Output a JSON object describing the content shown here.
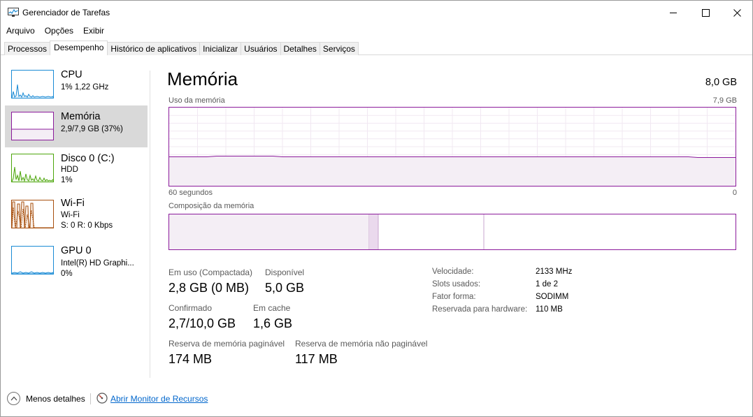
{
  "window": {
    "title": "Gerenciador de Tarefas"
  },
  "menu": [
    "Arquivo",
    "Opções",
    "Exibir"
  ],
  "tabs": [
    "Processos",
    "Desempenho",
    "Histórico de aplicativos",
    "Inicializar",
    "Usuários",
    "Detalhes",
    "Serviços"
  ],
  "active_tab": "Desempenho",
  "sidebar": {
    "items": [
      {
        "name": "CPU",
        "line1": "1%  1,22 GHz",
        "line2": "",
        "color": "#1a8bd5"
      },
      {
        "name": "Memória",
        "line1": "2,9/7,9 GB (37%)",
        "line2": "",
        "color": "#8b1a9b"
      },
      {
        "name": "Disco 0 (C:)",
        "line1": "HDD",
        "line2": "1%",
        "color": "#4da60c"
      },
      {
        "name": "Wi-Fi",
        "line1": "Wi-Fi",
        "line2": "S: 0  R: 0 Kbps",
        "color": "#a7500f"
      },
      {
        "name": "GPU 0",
        "line1": "Intel(R) HD Graphi...",
        "line2": "0%",
        "color": "#1a8bd5"
      }
    ]
  },
  "main": {
    "title": "Memória",
    "total": "8,0 GB",
    "usage_label": "Uso da memória",
    "usage_max": "7,9 GB",
    "time_left": "60 segundos",
    "time_right": "0",
    "composition_label": "Composição da memória",
    "usage_fraction": 0.37,
    "stats": {
      "in_use_label": "Em uso (Compactada)",
      "in_use_value": "2,8 GB (0 MB)",
      "available_label": "Disponível",
      "available_value": "5,0 GB",
      "committed_label": "Confirmado",
      "committed_value": "2,7/10,0 GB",
      "cached_label": "Em cache",
      "cached_value": "1,6 GB",
      "paged_label": "Reserva de memória paginável",
      "paged_value": "174 MB",
      "nonpaged_label": "Reserva de memória não paginável",
      "nonpaged_value": "117 MB"
    },
    "specs": [
      {
        "key": "Velocidade:",
        "value": "2133 MHz"
      },
      {
        "key": "Slots usados:",
        "value": "1 de 2"
      },
      {
        "key": "Fator forma:",
        "value": "SODIMM"
      },
      {
        "key": "Reservada para hardware:",
        "value": "110 MB"
      }
    ]
  },
  "footer": {
    "less_details": "Menos detalhes",
    "open_monitor": "Abrir Monitor de Recursos"
  },
  "colors": {
    "memory": "#8b1a9b",
    "memory_fill": "#f4eef5",
    "selected_bg": "#d9d9d9",
    "link": "#0066cc"
  }
}
